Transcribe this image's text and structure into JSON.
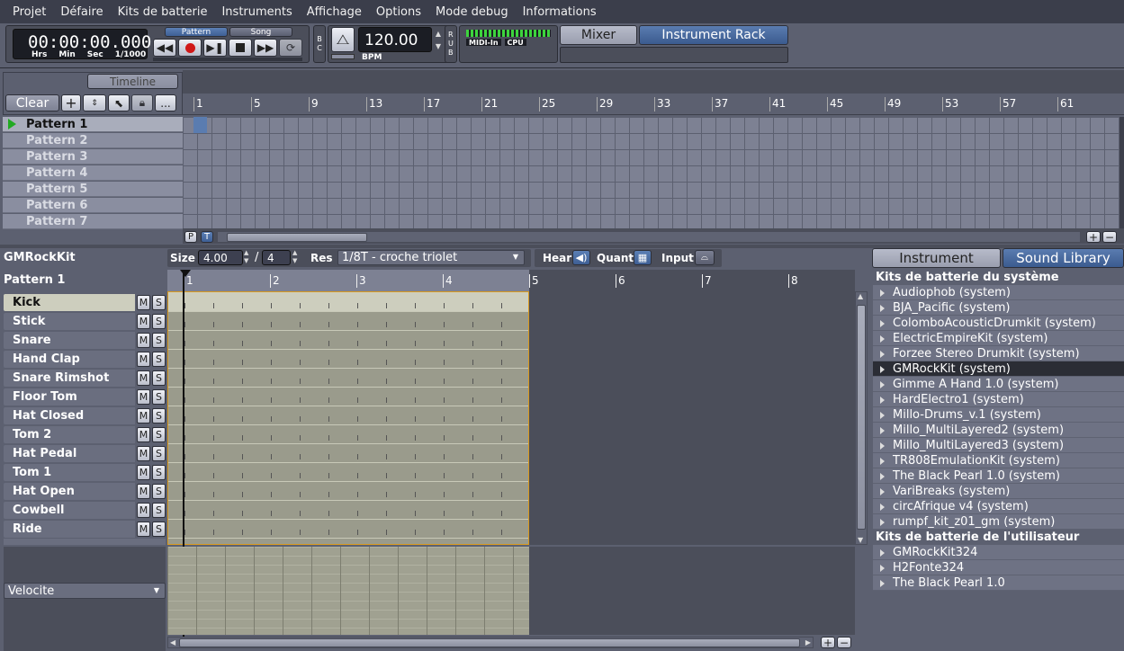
{
  "menu": [
    "Projet",
    "Défaire",
    "Kits de batterie",
    "Instruments",
    "Affichage",
    "Options",
    "Mode debug",
    "Informations"
  ],
  "transport": {
    "time": "00:00:00.000",
    "units": [
      "Hrs",
      "Min",
      "Sec",
      "1/1000"
    ],
    "pattern_label": "Pattern",
    "song_label": "Song",
    "bc": "B C",
    "bpm_value": "120.00",
    "bpm_label": "BPM",
    "rub": "R U B",
    "midi_in": "MIDI-In",
    "cpu": "CPU",
    "mixer": "Mixer",
    "instrument_rack": "Instrument Rack"
  },
  "song_editor": {
    "timeline_label": "Timeline",
    "clear_label": "Clear",
    "more_label": "...",
    "ruler": [
      "1",
      "5",
      "9",
      "13",
      "17",
      "21",
      "25",
      "29",
      "33",
      "37",
      "41",
      "45",
      "49",
      "53",
      "57",
      "61"
    ],
    "patterns": [
      "Pattern 1",
      "Pattern 2",
      "Pattern 3",
      "Pattern 4",
      "Pattern 5",
      "Pattern 6",
      "Pattern 7"
    ],
    "p_btn": "P",
    "t_btn": "T"
  },
  "pattern_editor": {
    "kit_name": "GMRockKit",
    "pattern_name": "Pattern 1",
    "size_label": "Size",
    "size_value": "4.00",
    "size_slash": "/",
    "size_denom": "4",
    "res_label": "Res",
    "res_value": "1/8T - croche triolet",
    "hear_label": "Hear",
    "quant_label": "Quant",
    "input_label": "Input",
    "ruler": [
      "1",
      "2",
      "3",
      "4",
      "5",
      "6",
      "7",
      "8"
    ],
    "instruments": [
      "Kick",
      "Stick",
      "Snare",
      "Hand Clap",
      "Snare Rimshot",
      "Floor Tom",
      "Hat Closed",
      "Tom 2",
      "Hat Pedal",
      "Tom 1",
      "Hat Open",
      "Cowbell",
      "Ride"
    ],
    "mute_label": "M",
    "solo_label": "S",
    "velocity_label": "Velocite"
  },
  "library": {
    "tab_instrument": "Instrument",
    "tab_sound_library": "Sound Library",
    "system_header": "Kits de batterie du système",
    "system_kits": [
      "Audiophob (system)",
      "BJA_Pacific (system)",
      "ColomboAcousticDrumkit (system)",
      "ElectricEmpireKit (system)",
      "Forzee Stereo Drumkit (system)",
      "GMRockKit (system)",
      "Gimme A Hand 1.0 (system)",
      "HardElectro1 (system)",
      "Millo-Drums_v.1 (system)",
      "Millo_MultiLayered2 (system)",
      "Millo_MultiLayered3 (system)",
      "TR808EmulationKit (system)",
      "The Black Pearl 1.0 (system)",
      "VariBreaks (system)",
      "circAfrique v4 (system)",
      "rumpf_kit_z01_gm (system)"
    ],
    "user_header": "Kits de batterie de l'utilisateur",
    "user_kits": [
      "GMRockKit324",
      "H2Fonte324",
      "The Black Pearl 1.0"
    ],
    "selected_kit": "GMRockKit (system)"
  }
}
